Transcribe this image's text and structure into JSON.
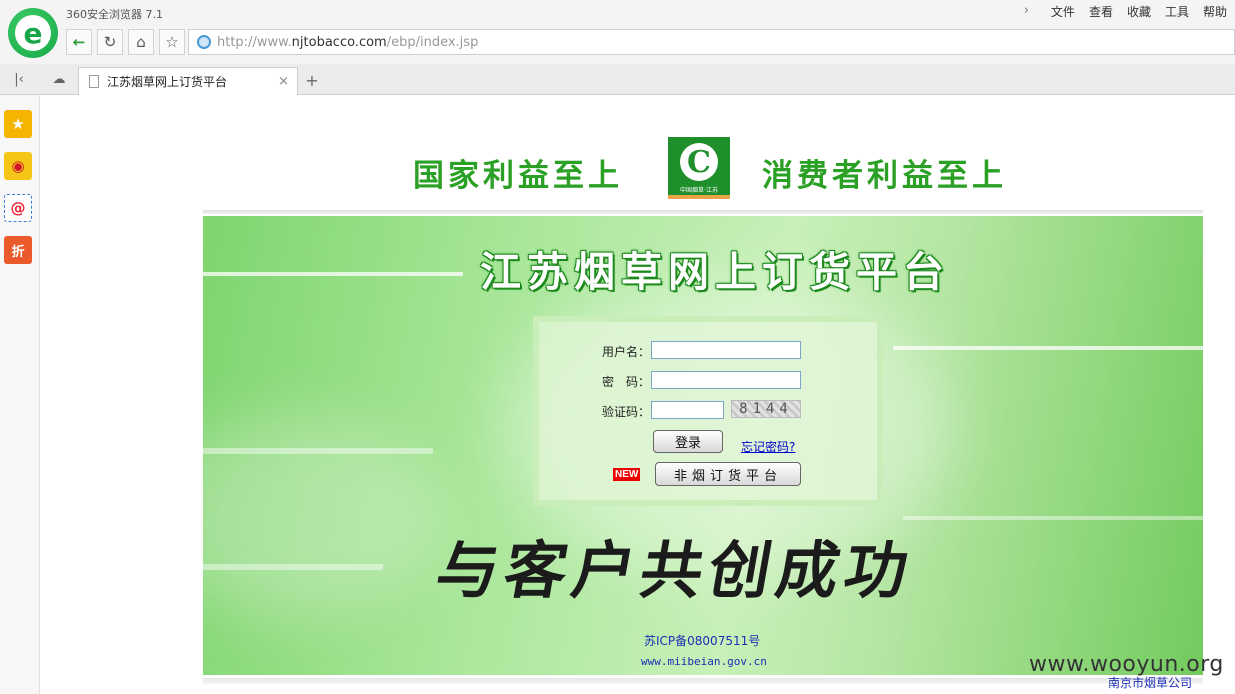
{
  "browser": {
    "app_title": "360安全浏览器 7.1",
    "menu": [
      "文件",
      "查看",
      "收藏",
      "工具",
      "帮助"
    ],
    "url_prefix": "http://www.",
    "url_domain": "njtobacco.com",
    "url_path": "/ebp/index.jsp",
    "tab_title": "江苏烟草网上订货平台"
  },
  "page": {
    "slogan_left": "国家利益至上",
    "slogan_right": "消费者利益至上",
    "badge_caption": "中国烟草·江苏",
    "banner_title": "江苏烟草网上订货平台",
    "login": {
      "username_label": "用户名：",
      "password_label": "密　码：",
      "captcha_label": "验证码：",
      "captcha_value": "8144",
      "login_button": "登录",
      "forgot_link": "忘记密码?",
      "new_tag": "NEW",
      "platform_button": "非烟订货平台"
    },
    "calligraphy": "与客户共创成功",
    "icp": "苏ICP备08007511号",
    "miibeian": "www.miibeian.gov.cn",
    "footer_org": "南京市烟草公司",
    "watermark": "www.wooyun.org"
  }
}
